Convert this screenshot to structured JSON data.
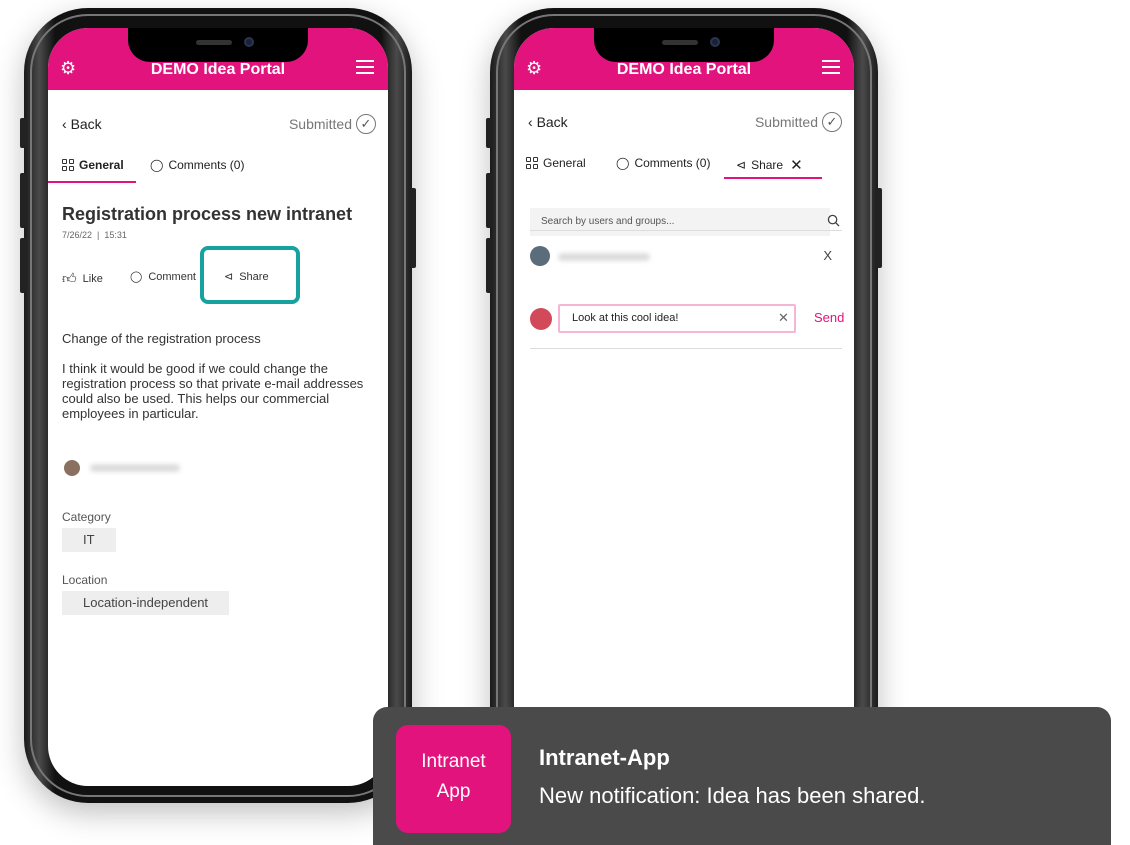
{
  "brand": {
    "accent": "#e2137d",
    "highlight": "#17a2a0",
    "toast_bg": "#4a4a4a"
  },
  "left_screen": {
    "app_title": "DEMO Idea Portal",
    "back_label": "Back",
    "status": "Submitted",
    "tabs": [
      {
        "label": "General",
        "icon": "grid-icon"
      },
      {
        "label": "Comments (0)",
        "icon": "comment-icon"
      }
    ],
    "idea_title": "Registration process new intranet",
    "date": "7/26/22",
    "time": "15:31",
    "actions": {
      "like": "Like",
      "comment": "Comment",
      "share": "Share"
    },
    "summary": "Change of the registration process",
    "description": "I think it would be good if we could change the registration process so that private e-mail addresses could also be used. This helps our commercial employees in particular.",
    "category_label": "Category",
    "category_value": "IT",
    "location_label": "Location",
    "location_value": "Location-independent"
  },
  "right_screen": {
    "app_title": "DEMO Idea Portal",
    "back_label": "Back",
    "status": "Submitted",
    "tabs": [
      {
        "label": "General",
        "icon": "grid-icon"
      },
      {
        "label": "Comments (0)",
        "icon": "comment-icon"
      },
      {
        "label": "Share",
        "icon": "share-icon"
      }
    ],
    "search_placeholder": "Search by users and groups...",
    "remove_label": "X",
    "message_value": "Look at this cool idea!",
    "send_label": "Send"
  },
  "notification": {
    "app_icon_line1": "Intranet",
    "app_icon_line2": "App",
    "title": "Intranet-App",
    "message": "New notification: Idea has been shared."
  }
}
